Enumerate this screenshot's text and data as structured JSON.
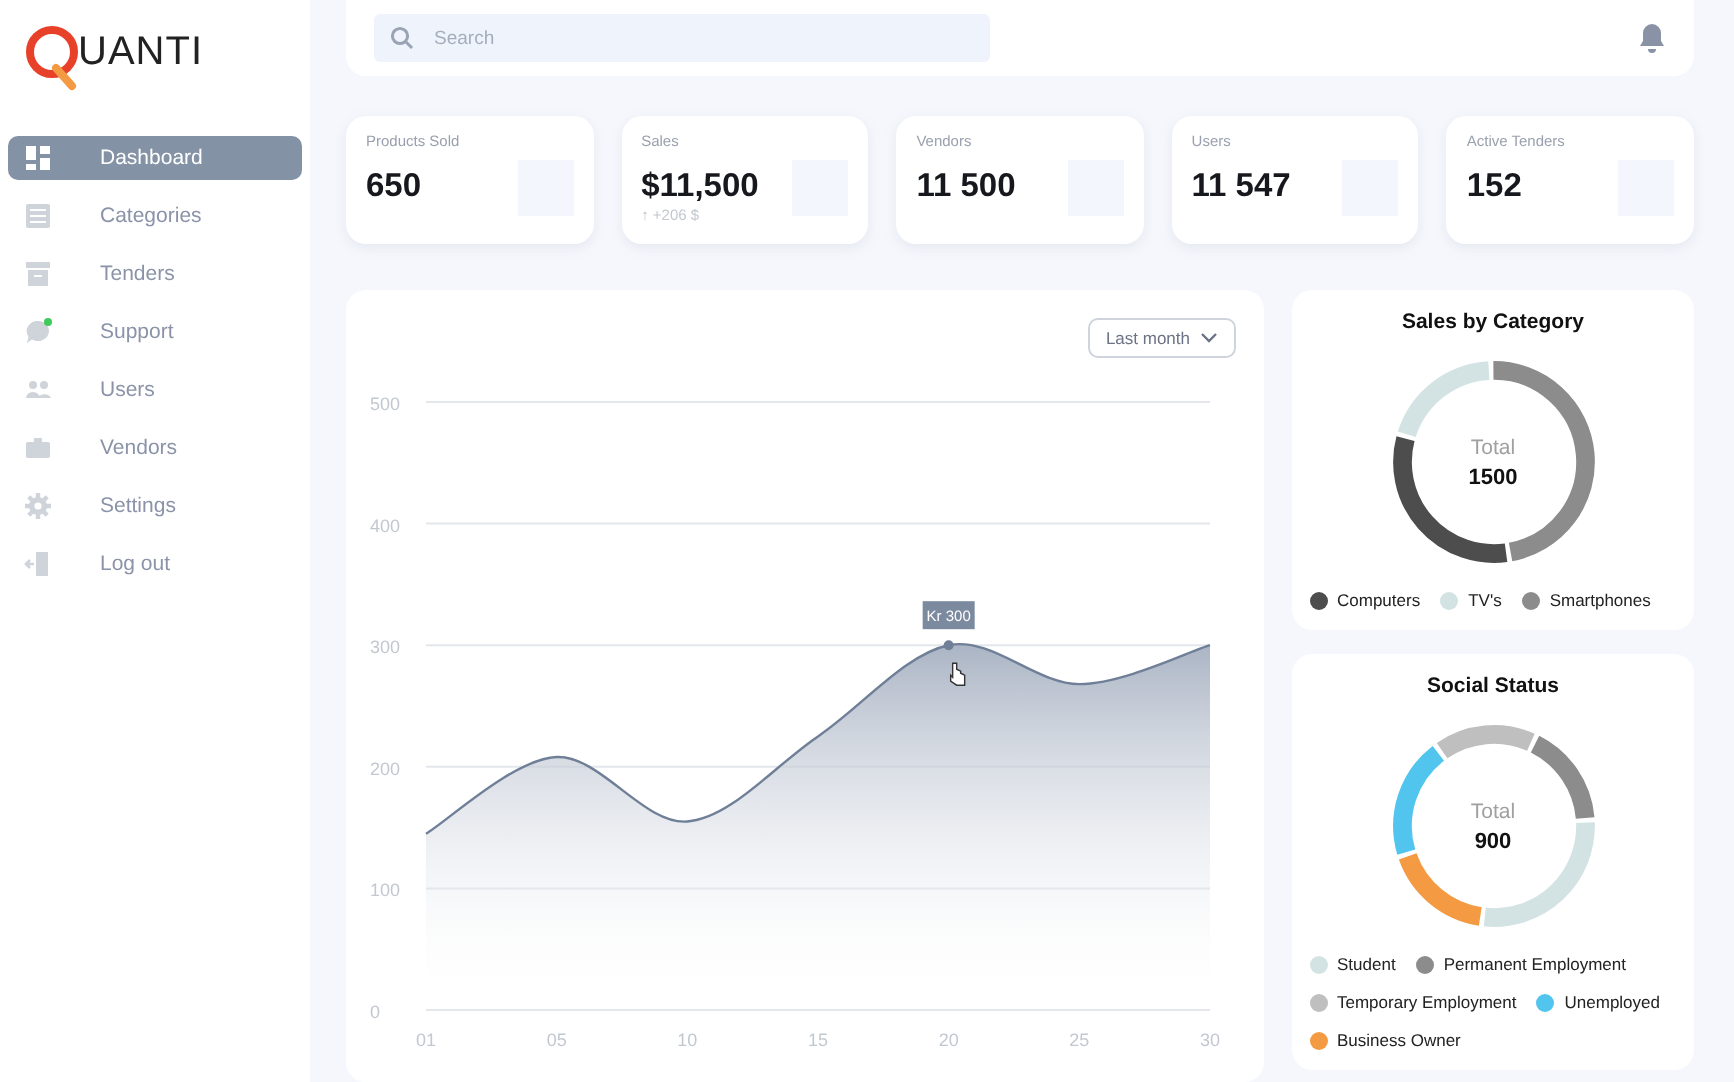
{
  "logo": {
    "text": "UANTI"
  },
  "sidebar": {
    "items": [
      {
        "label": "Dashboard",
        "selected": true,
        "badge": false
      },
      {
        "label": "Categories",
        "selected": false,
        "badge": false
      },
      {
        "label": "Tenders",
        "selected": false,
        "badge": false
      },
      {
        "label": "Support",
        "selected": false,
        "badge": true
      },
      {
        "label": "Users",
        "selected": false,
        "badge": false
      },
      {
        "label": "Vendors",
        "selected": false,
        "badge": false
      },
      {
        "label": "Settings",
        "selected": false,
        "badge": false
      },
      {
        "label": "Log out",
        "selected": false,
        "badge": false
      }
    ]
  },
  "search": {
    "placeholder": "Search"
  },
  "stats": [
    {
      "label": "Products Sold",
      "value": "650"
    },
    {
      "label": "Sales",
      "value": "$11,500",
      "change": "↑ +206 $"
    },
    {
      "label": "Vendors",
      "value": "11 500"
    },
    {
      "label": "Users",
      "value": "11 547"
    },
    {
      "label": "Active Tenders",
      "value": "152"
    }
  ],
  "main_chart": {
    "period": "Last month",
    "tooltip": "Kr 300",
    "chart_data": {
      "type": "area",
      "categories": [
        "01",
        "05",
        "10",
        "15",
        "20",
        "25",
        "30"
      ],
      "grid": true,
      "series": [
        {
          "color": "#6f7f97",
          "values": [
            145,
            208,
            155,
            225,
            300,
            268,
            300
          ]
        }
      ],
      "ylim": [
        0,
        500
      ],
      "yticks": [
        0,
        100,
        200,
        300,
        400,
        500
      ]
    }
  },
  "sales_by_category": {
    "title": "Sales by Category",
    "total_label": "Total",
    "total": "1500",
    "legend": [
      {
        "label": "Computers",
        "color": "#4d4d4d"
      },
      {
        "label": "TV's",
        "color": "#d3e3e3"
      },
      {
        "label": "Smartphones",
        "color": "#8c8c8c"
      }
    ]
  },
  "social_status": {
    "title": "Social Status",
    "total_label": "Total",
    "total": "900",
    "legend": [
      {
        "label": "Student",
        "color": "#d3e3e3"
      },
      {
        "label": "Permanent Employment",
        "color": "#8c8c8c"
      },
      {
        "label": "Temporary Employment",
        "color": "#bfbfbf"
      },
      {
        "label": "Unemployed",
        "color": "#52c5ee"
      },
      {
        "label": "Business Owner",
        "color": "#f39a43"
      }
    ]
  }
}
